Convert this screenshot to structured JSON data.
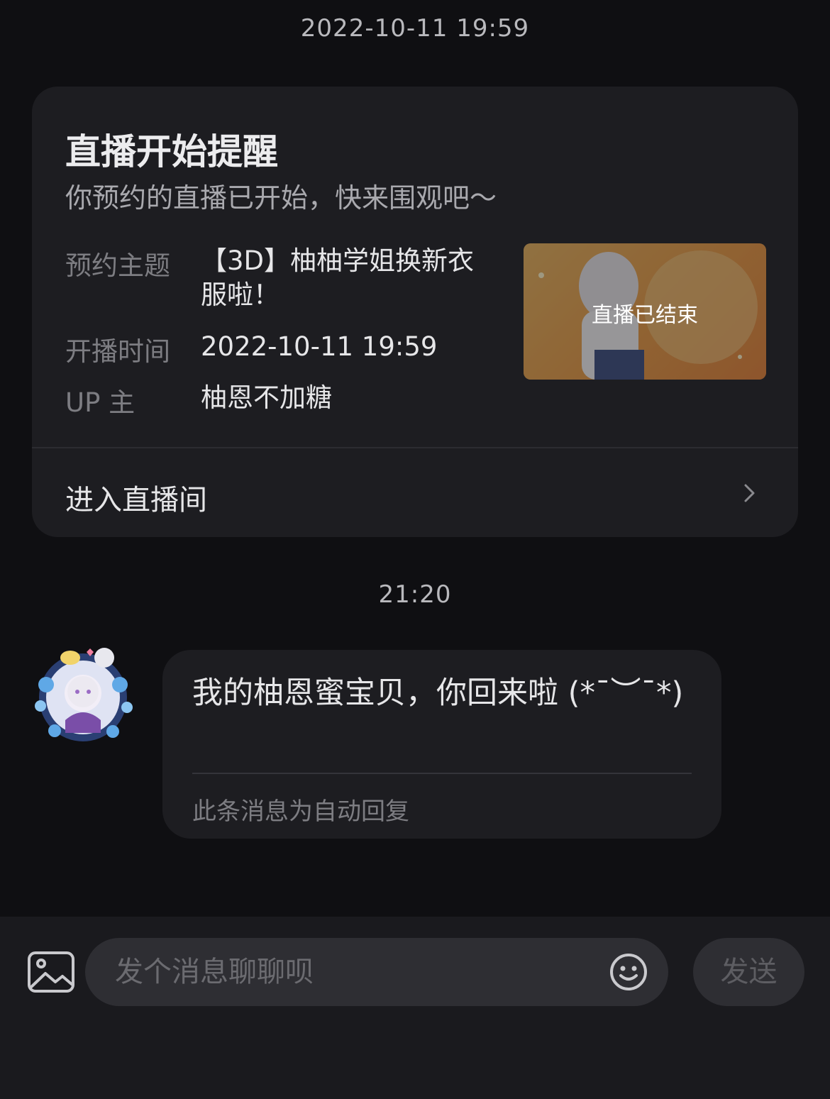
{
  "timestamps": {
    "first": "2022-10-11 19:59",
    "second": "21:20"
  },
  "live_card": {
    "title": "直播开始提醒",
    "subtitle": "你预约的直播已开始，快来围观吧～",
    "topic_label": "预约主题",
    "topic_value": "【3D】柚柚学姐换新衣服啦！",
    "start_label": "开播时间",
    "start_value": "2022-10-11 19:59",
    "up_label": "UP 主",
    "up_value": "柚恩不加糖",
    "thumbnail_status": "直播已结束",
    "enter_label": "进入直播间"
  },
  "message": {
    "text": "我的柚恩蜜宝贝，你回来啦 (*¯︶¯*)",
    "auto_reply_note": "此条消息为自动回复"
  },
  "composer": {
    "placeholder": "发个消息聊聊呗",
    "send_label": "发送"
  },
  "icons": {
    "image": "image-icon",
    "emoji": "emoji-icon",
    "chevron": "chevron-right-icon"
  }
}
